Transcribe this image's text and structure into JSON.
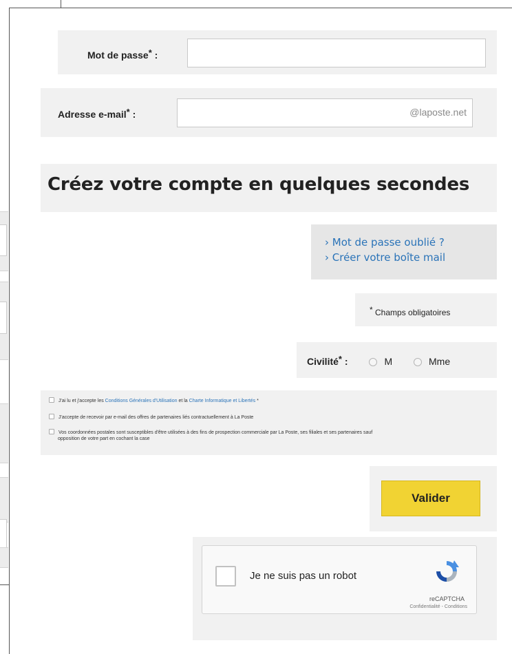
{
  "form": {
    "password_label": "Mot de passe",
    "email_label": "Adresse e-mail",
    "required_star": "*",
    "label_colon": ":",
    "email_suffix": "@laposte.net",
    "password_value": "",
    "email_value": ""
  },
  "heading": "Créez votre compte en quelques secondes",
  "links": {
    "forgot_password": "› Mot de passe oublié ?",
    "create_mailbox": "› Créer votre boîte mail"
  },
  "required_note": "Champs obligatoires",
  "civility": {
    "label": "Civilité",
    "options": [
      "M",
      "Mme"
    ]
  },
  "terms": {
    "line1_prefix": "J'ai lu et j'accepte les",
    "line1_link1": "Conditions Générales d'Utilisation",
    "line1_and": "et la",
    "line1_link2": "Charte Informatique et Libertés",
    "line1_star": "*",
    "line2": "J'accepte de recevoir par e-mail des offres de partenaires liés contractuellement à La Poste",
    "line3a": "Vos coordonnées postales sont susceptibles d'être utilisées à des fins de prospection commerciale par La Poste, ses filiales et ses partenaires sauf",
    "line3b": "opposition de votre part en cochant la case"
  },
  "submit_label": "Valider",
  "captcha": {
    "label": "Je ne suis pas un robot",
    "brand": "reCAPTCHA",
    "links": "Confidentialité - Conditions"
  },
  "colors": {
    "accent_yellow": "#f1d333",
    "link_blue": "#2a73b8",
    "panel_grey": "#f1f1f1"
  }
}
